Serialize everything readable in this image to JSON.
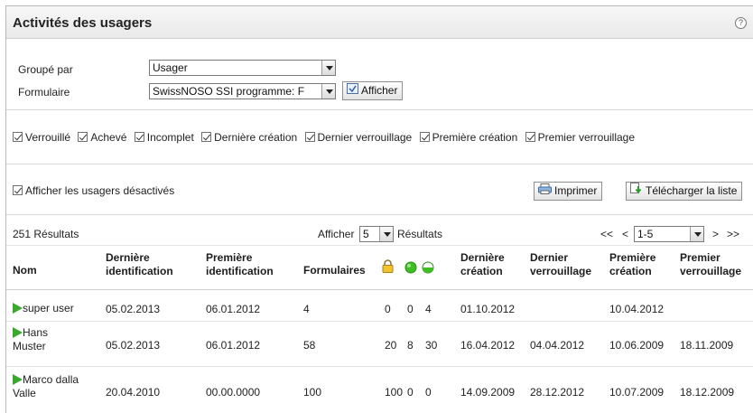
{
  "title": "Activités des usagers",
  "help_icon": "question-circle-icon",
  "group_by": {
    "label": "Groupé par",
    "value": "Usager"
  },
  "form": {
    "label": "Formulaire",
    "value": "SwissNOSO SSI programme: F"
  },
  "show_button": "Afficher",
  "filters": [
    "Verrouillé",
    "Achevé",
    "Incomplet",
    "Dernière création",
    "Dernier verrouillage",
    "Première création",
    "Premier verrouillage"
  ],
  "show_disabled": "Afficher les usagers désactivés",
  "print_button": "Imprimer",
  "download_button": "Télécharger la liste",
  "results": {
    "count": "251 Résultats",
    "show_label": "Afficher",
    "per_page": "5",
    "results_label": "Résultats",
    "first": "<<",
    "prev": "<",
    "page_range": "1-5",
    "next": ">",
    "last": ">>"
  },
  "columns": {
    "nom": "Nom",
    "derniere_ident_1": "Dernière",
    "derniere_ident_2": "identification",
    "premiere_ident_1": "Première",
    "premiere_ident_2": "identification",
    "formulaires": "Formulaires",
    "derniere_creation_1": "Dernière",
    "derniere_creation_2": "création",
    "dernier_verr_1": "Dernier",
    "dernier_verr_2": "verrouillage",
    "premiere_creation_1": "Première",
    "premiere_creation_2": "création",
    "premier_verr_1": "Premier",
    "premier_verr_2": "verrouillage"
  },
  "rows": [
    {
      "name1": "super user",
      "name2": "",
      "last_login": "05.02.2013",
      "first_login": "06.01.2012",
      "forms": "4",
      "locked": "0",
      "complete": "0",
      "incomplete": "4",
      "last_created": "01.10.2012",
      "last_locked": "",
      "first_created": "10.04.2012",
      "first_locked": ""
    },
    {
      "name1": "Hans",
      "name2": "Muster",
      "last_login": "05.02.2013",
      "first_login": "06.01.2012",
      "forms": "58",
      "locked": "20",
      "complete": "8",
      "incomplete": "30",
      "last_created": "16.04.2012",
      "last_locked": "04.04.2012",
      "first_created": "10.06.2009",
      "first_locked": "18.11.2009"
    },
    {
      "name1": "Marco dalla",
      "name2": "Valle",
      "last_login": "20.04.2010",
      "first_login": "00.00.0000",
      "forms": "100",
      "locked": "100",
      "complete": "0",
      "incomplete": "0",
      "last_created": "14.09.2009",
      "last_locked": "28.12.2012",
      "first_created": "10.07.2009",
      "first_locked": "18.12.2009"
    }
  ]
}
